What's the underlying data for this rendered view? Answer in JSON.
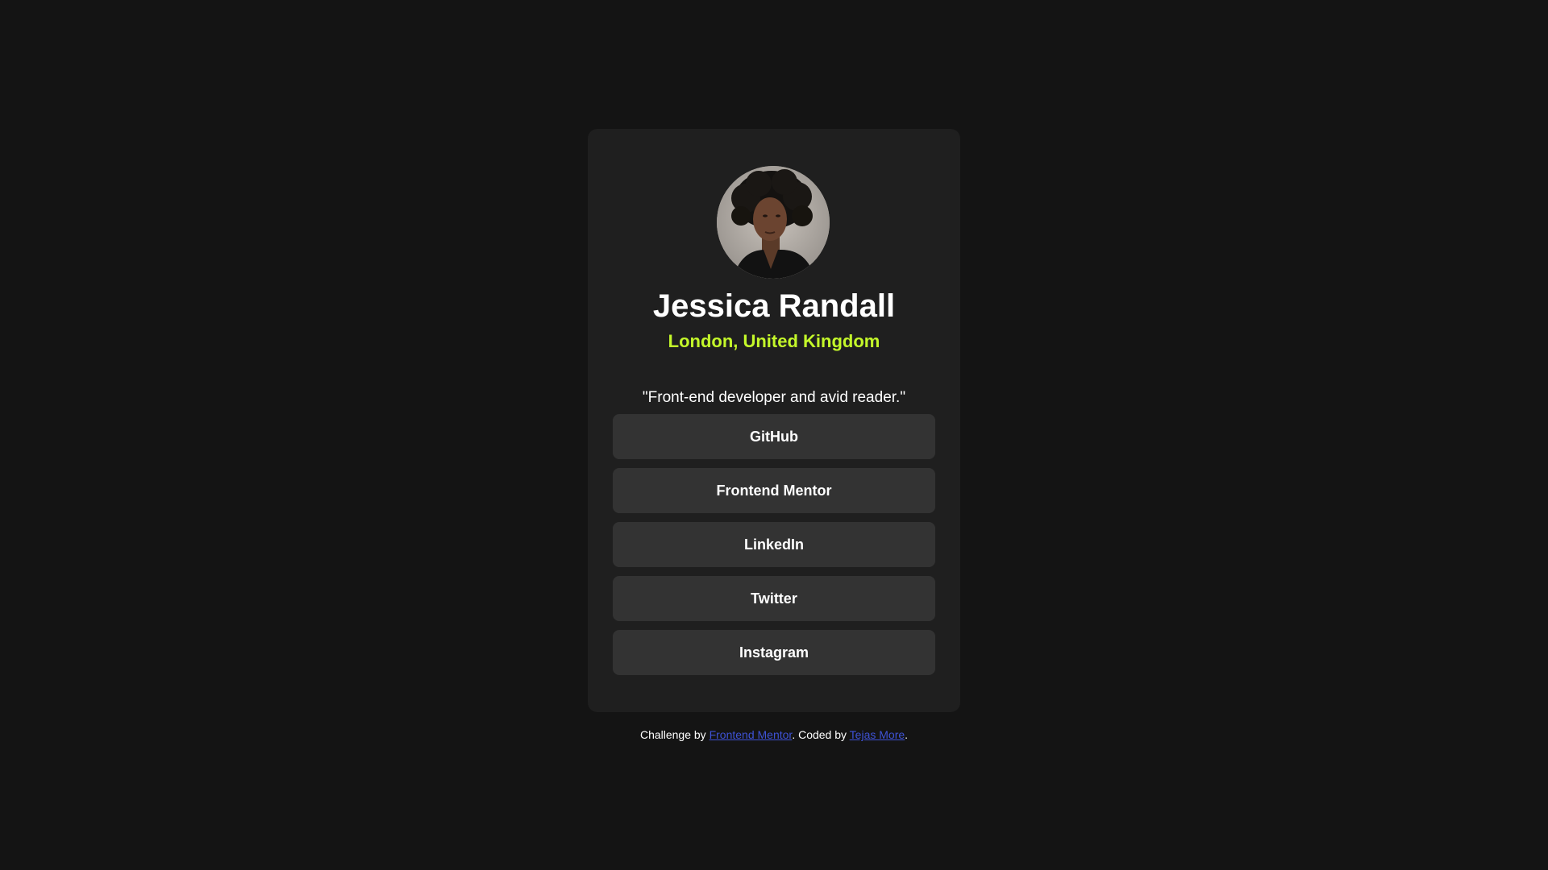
{
  "profile": {
    "name": "Jessica Randall",
    "location": "London, United Kingdom",
    "bio": "\"Front-end developer and avid reader.\"",
    "avatar_icon": "person-portrait-icon"
  },
  "links": [
    {
      "label": "GitHub"
    },
    {
      "label": "Frontend Mentor"
    },
    {
      "label": "LinkedIn"
    },
    {
      "label": "Twitter"
    },
    {
      "label": "Instagram"
    }
  ],
  "attribution": {
    "prefix": "Challenge by ",
    "challenge_link": "Frontend Mentor",
    "middle": ". Coded by ",
    "author_link": "Tejas More",
    "suffix": "."
  },
  "colors": {
    "background": "#141414",
    "card": "#1f1f1f",
    "button": "#333333",
    "accent": "#c4f82a",
    "link": "#3e52d5"
  }
}
